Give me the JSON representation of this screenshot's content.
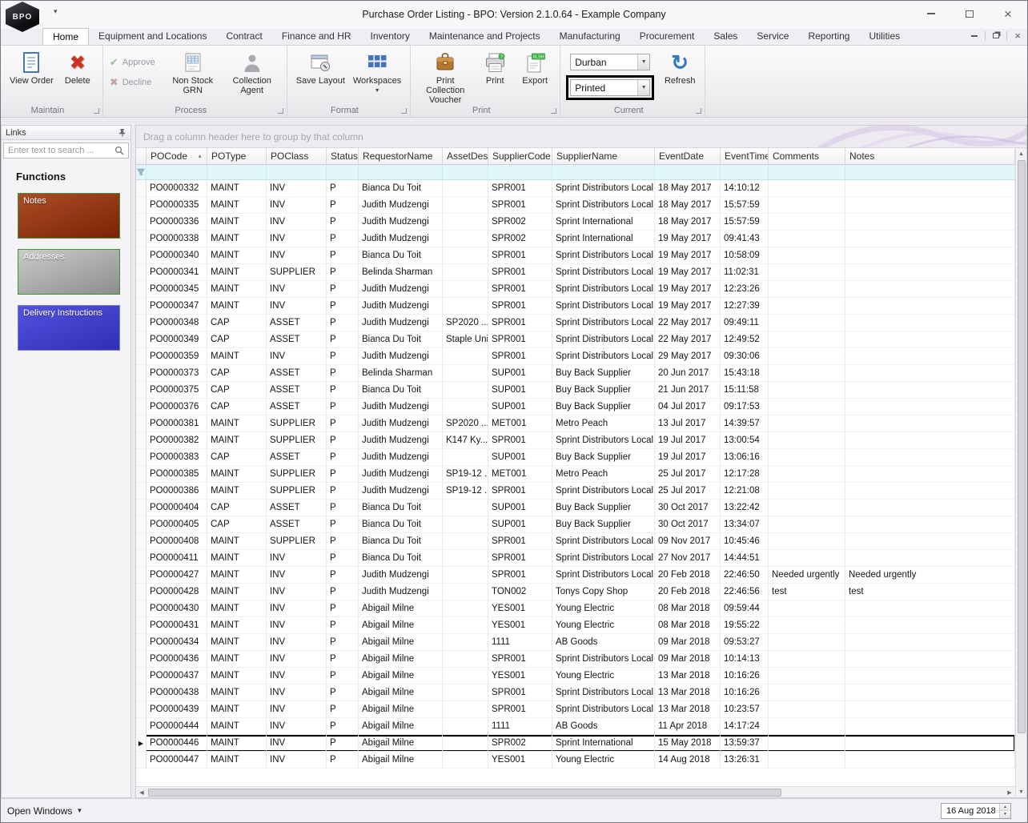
{
  "titlebar": {
    "title": "Purchase Order Listing - BPO: Version 2.1.0.64 - Example Company",
    "logo_text": "BPO"
  },
  "tabs": [
    "Home",
    "Equipment and Locations",
    "Contract",
    "Finance and HR",
    "Inventory",
    "Maintenance and Projects",
    "Manufacturing",
    "Procurement",
    "Sales",
    "Service",
    "Reporting",
    "Utilities"
  ],
  "active_tab": "Home",
  "ribbon": {
    "maintain": {
      "label": "Maintain",
      "view_order": "View Order",
      "delete": "Delete"
    },
    "process": {
      "label": "Process",
      "approve": "Approve",
      "decline": "Decline",
      "non_stock_grn": "Non Stock GRN",
      "collection_agent": "Collection Agent"
    },
    "format": {
      "label": "Format",
      "save_layout": "Save Layout",
      "workspaces": "Workspaces"
    },
    "print": {
      "label": "Print",
      "voucher": "Print Collection Voucher",
      "print": "Print",
      "export": "Export",
      "export_badge": "XLSH"
    },
    "current": {
      "label": "Current",
      "site_value": "Durban",
      "status_value": "Printed",
      "refresh": "Refresh",
      "highlight_color": "#000000"
    }
  },
  "sidebar": {
    "panel_title": "Links",
    "search_placeholder": "Enter text to search ...",
    "section_title": "Functions",
    "functions": [
      {
        "label": "Notes",
        "gradient_from": "#ab4d27",
        "gradient_to": "#7c2304",
        "border": "#3f8f3f"
      },
      {
        "label": "Addresses",
        "gradient_from": "#cbcbcb",
        "gradient_to": "#8d8d8d",
        "border": "#3f8f3f"
      },
      {
        "label": "Delivery Instructions",
        "gradient_from": "#5353de",
        "gradient_to": "#2e2eb6",
        "border": "#7c7cd4"
      }
    ]
  },
  "grid": {
    "group_hint": "Drag a column header here to group by that column",
    "columns": [
      "POCode",
      "POType",
      "POClass",
      "Status",
      "RequestorName",
      "AssetDesc",
      "SupplierCode",
      "SupplierName",
      "EventDate",
      "EventTime",
      "Comments",
      "Notes"
    ],
    "sort_column": "POCode",
    "sort_direction": "asc",
    "selected_pocode": "PO0000446",
    "rows": [
      [
        "PO0000332",
        "MAINT",
        "INV",
        "P",
        "Bianca Du Toit",
        "",
        "SPR001",
        "Sprint Distributors Local",
        "18 May 2017",
        "14:10:12",
        "",
        ""
      ],
      [
        "PO0000335",
        "MAINT",
        "INV",
        "P",
        "Judith Mudzengi",
        "",
        "SPR001",
        "Sprint Distributors Local",
        "18 May 2017",
        "15:57:59",
        "",
        ""
      ],
      [
        "PO0000336",
        "MAINT",
        "INV",
        "P",
        "Judith Mudzengi",
        "",
        "SPR002",
        "Sprint International",
        "18 May 2017",
        "15:57:59",
        "",
        ""
      ],
      [
        "PO0000338",
        "MAINT",
        "INV",
        "P",
        "Judith Mudzengi",
        "",
        "SPR002",
        "Sprint International",
        "19 May 2017",
        "09:41:43",
        "",
        ""
      ],
      [
        "PO0000340",
        "MAINT",
        "INV",
        "P",
        "Bianca Du Toit",
        "",
        "SPR001",
        "Sprint Distributors Local",
        "19 May 2017",
        "10:58:09",
        "",
        ""
      ],
      [
        "PO0000341",
        "MAINT",
        "SUPPLIER",
        "P",
        "Belinda Sharman",
        "",
        "SPR001",
        "Sprint Distributors Local",
        "19 May 2017",
        "11:02:31",
        "",
        ""
      ],
      [
        "PO0000345",
        "MAINT",
        "INV",
        "P",
        "Judith Mudzengi",
        "",
        "SPR001",
        "Sprint Distributors Local",
        "19 May 2017",
        "12:23:26",
        "",
        ""
      ],
      [
        "PO0000347",
        "MAINT",
        "INV",
        "P",
        "Judith Mudzengi",
        "",
        "SPR001",
        "Sprint Distributors Local",
        "19 May 2017",
        "12:27:39",
        "",
        ""
      ],
      [
        "PO0000348",
        "CAP",
        "ASSET",
        "P",
        "Judith Mudzengi",
        "SP2020 ...",
        "SPR001",
        "Sprint Distributors Local",
        "22 May 2017",
        "09:49:11",
        "",
        ""
      ],
      [
        "PO0000349",
        "CAP",
        "ASSET",
        "P",
        "Bianca Du Toit",
        "Staple Unit",
        "SPR001",
        "Sprint Distributors Local",
        "22 May 2017",
        "12:49:52",
        "",
        ""
      ],
      [
        "PO0000359",
        "MAINT",
        "INV",
        "P",
        "Judith Mudzengi",
        "",
        "SPR001",
        "Sprint Distributors Local",
        "29 May 2017",
        "09:30:06",
        "",
        ""
      ],
      [
        "PO0000373",
        "CAP",
        "ASSET",
        "P",
        "Belinda Sharman",
        "",
        "SUP001",
        "Buy Back Supplier",
        "20 Jun 2017",
        "15:43:18",
        "",
        ""
      ],
      [
        "PO0000375",
        "CAP",
        "ASSET",
        "P",
        "Bianca Du Toit",
        "",
        "SUP001",
        "Buy Back Supplier",
        "21 Jun 2017",
        "15:11:58",
        "",
        ""
      ],
      [
        "PO0000376",
        "CAP",
        "ASSET",
        "P",
        "Judith Mudzengi",
        "",
        "SUP001",
        "Buy Back Supplier",
        "04 Jul 2017",
        "09:17:53",
        "",
        ""
      ],
      [
        "PO0000381",
        "MAINT",
        "SUPPLIER",
        "P",
        "Judith Mudzengi",
        "SP2020 ...",
        "MET001",
        "Metro Peach",
        "13 Jul 2017",
        "14:39:57",
        "",
        ""
      ],
      [
        "PO0000382",
        "MAINT",
        "SUPPLIER",
        "P",
        "Judith Mudzengi",
        "K147 Ky...",
        "SPR001",
        "Sprint Distributors Local",
        "19 Jul 2017",
        "13:00:54",
        "",
        ""
      ],
      [
        "PO0000383",
        "CAP",
        "ASSET",
        "P",
        "Judith Mudzengi",
        "",
        "SUP001",
        "Buy Back Supplier",
        "19 Jul 2017",
        "13:06:16",
        "",
        ""
      ],
      [
        "PO0000385",
        "MAINT",
        "SUPPLIER",
        "P",
        "Judith Mudzengi",
        "SP19-12 ...",
        "MET001",
        "Metro Peach",
        "25 Jul 2017",
        "12:17:28",
        "",
        ""
      ],
      [
        "PO0000386",
        "MAINT",
        "SUPPLIER",
        "P",
        "Judith Mudzengi",
        "SP19-12 ...",
        "SPR001",
        "Sprint Distributors Local",
        "25 Jul 2017",
        "12:21:08",
        "",
        ""
      ],
      [
        "PO0000404",
        "CAP",
        "ASSET",
        "P",
        "Bianca Du Toit",
        "",
        "SUP001",
        "Buy Back Supplier",
        "30 Oct 2017",
        "13:22:42",
        "",
        ""
      ],
      [
        "PO0000405",
        "CAP",
        "ASSET",
        "P",
        "Bianca Du Toit",
        "",
        "SUP001",
        "Buy Back Supplier",
        "30 Oct 2017",
        "13:34:07",
        "",
        ""
      ],
      [
        "PO0000408",
        "MAINT",
        "SUPPLIER",
        "P",
        "Bianca Du Toit",
        "",
        "SPR001",
        "Sprint Distributors Local",
        "09 Nov 2017",
        "10:45:46",
        "",
        ""
      ],
      [
        "PO0000411",
        "MAINT",
        "INV",
        "P",
        "Bianca Du Toit",
        "",
        "SPR001",
        "Sprint Distributors Local",
        "27 Nov 2017",
        "14:44:51",
        "",
        ""
      ],
      [
        "PO0000427",
        "MAINT",
        "INV",
        "P",
        "Judith Mudzengi",
        "",
        "SPR001",
        "Sprint Distributors Local",
        "20 Feb 2018",
        "22:46:50",
        "Needed urgently",
        "Needed urgently"
      ],
      [
        "PO0000428",
        "MAINT",
        "INV",
        "P",
        "Judith Mudzengi",
        "",
        "TON002",
        "Tonys Copy Shop",
        "20 Feb 2018",
        "22:46:56",
        "test",
        "test"
      ],
      [
        "PO0000430",
        "MAINT",
        "INV",
        "P",
        "Abigail Milne",
        "",
        "YES001",
        "Young Electric",
        "08 Mar 2018",
        "09:59:44",
        "",
        ""
      ],
      [
        "PO0000431",
        "MAINT",
        "INV",
        "P",
        "Abigail Milne",
        "",
        "YES001",
        "Young Electric",
        "08 Mar 2018",
        "19:55:22",
        "",
        ""
      ],
      [
        "PO0000434",
        "MAINT",
        "INV",
        "P",
        "Abigail Milne",
        "",
        "1111",
        "AB Goods",
        "09 Mar 2018",
        "09:53:27",
        "",
        ""
      ],
      [
        "PO0000436",
        "MAINT",
        "INV",
        "P",
        "Abigail Milne",
        "",
        "SPR001",
        "Sprint Distributors Local",
        "09 Mar 2018",
        "10:14:13",
        "",
        ""
      ],
      [
        "PO0000437",
        "MAINT",
        "INV",
        "P",
        "Abigail Milne",
        "",
        "YES001",
        "Young Electric",
        "13 Mar 2018",
        "10:16:26",
        "",
        ""
      ],
      [
        "PO0000438",
        "MAINT",
        "INV",
        "P",
        "Abigail Milne",
        "",
        "SPR001",
        "Sprint Distributors Local",
        "13 Mar 2018",
        "10:16:26",
        "",
        ""
      ],
      [
        "PO0000439",
        "MAINT",
        "INV",
        "P",
        "Abigail Milne",
        "",
        "SPR001",
        "Sprint Distributors Local",
        "13 Mar 2018",
        "10:23:57",
        "",
        ""
      ],
      [
        "PO0000444",
        "MAINT",
        "INV",
        "P",
        "Abigail Milne",
        "",
        "1111",
        "AB Goods",
        "11 Apr 2018",
        "14:17:24",
        "",
        ""
      ],
      [
        "PO0000446",
        "MAINT",
        "INV",
        "P",
        "Abigail Milne",
        "",
        "SPR002",
        "Sprint International",
        "15 May 2018",
        "13:59:37",
        "",
        ""
      ],
      [
        "PO0000447",
        "MAINT",
        "INV",
        "P",
        "Abigail Milne",
        "",
        "YES001",
        "Young Electric",
        "14 Aug 2018",
        "13:26:31",
        "",
        ""
      ]
    ]
  },
  "statusbar": {
    "open_windows_label": "Open Windows",
    "date_value": "16 Aug 2018"
  }
}
